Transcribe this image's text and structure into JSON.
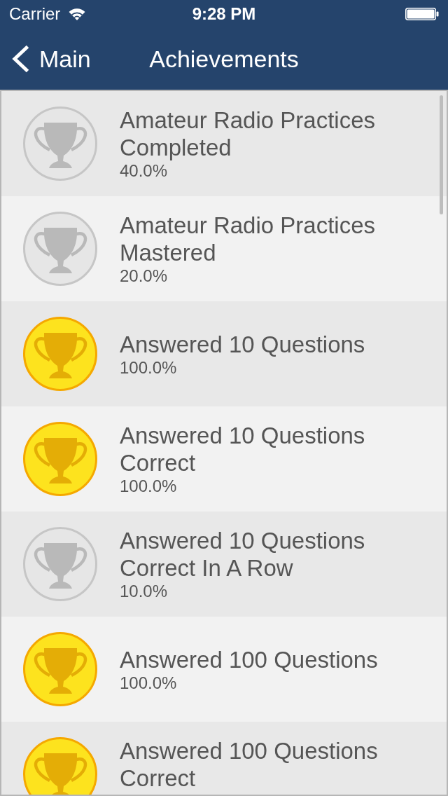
{
  "status_bar": {
    "carrier": "Carrier",
    "time": "9:28 PM"
  },
  "nav_bar": {
    "back": "Main",
    "title": "Achievements"
  },
  "achievements": [
    {
      "title": "Amateur Radio Practices Completed",
      "progress": "40.0%",
      "completed": false
    },
    {
      "title": "Amateur Radio Practices Mastered",
      "progress": "20.0%",
      "completed": false
    },
    {
      "title": "Answered 10 Questions",
      "progress": "100.0%",
      "completed": true
    },
    {
      "title": "Answered 10 Questions Correct",
      "progress": "100.0%",
      "completed": true
    },
    {
      "title": "Answered 10 Questions Correct In A Row",
      "progress": "10.0%",
      "completed": false
    },
    {
      "title": "Answered 100 Questions",
      "progress": "100.0%",
      "completed": true
    },
    {
      "title": "Answered 100 Questions Correct",
      "completed": true
    }
  ]
}
